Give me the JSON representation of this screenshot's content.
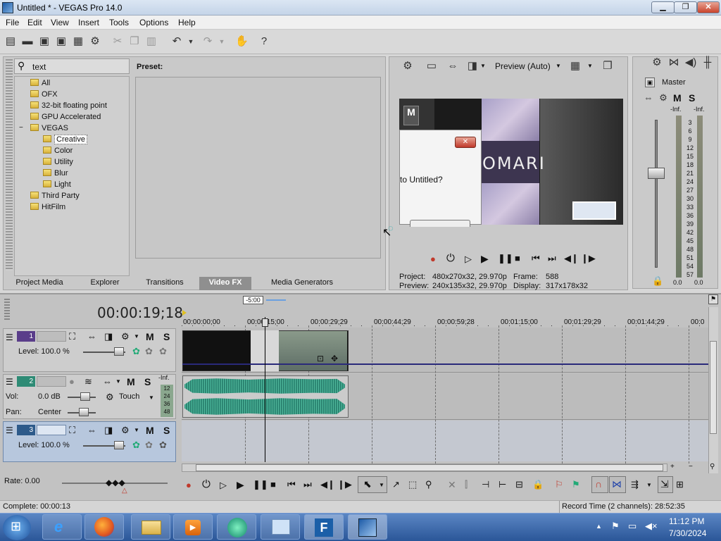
{
  "window": {
    "title": "Untitled * - VEGAS Pro 14.0",
    "minimize": "▁",
    "maximize": "❐",
    "close": "✕"
  },
  "menu": [
    "File",
    "Edit",
    "View",
    "Insert",
    "Tools",
    "Options",
    "Help"
  ],
  "fx_browser": {
    "search_value": "text",
    "preset_label": "Preset:",
    "tree": [
      {
        "label": "All",
        "indent": 1
      },
      {
        "label": "OFX",
        "indent": 1
      },
      {
        "label": "32-bit floating point",
        "indent": 1
      },
      {
        "label": "GPU Accelerated",
        "indent": 1
      },
      {
        "label": "VEGAS",
        "indent": 1,
        "expanded": true
      },
      {
        "label": "Creative",
        "indent": 2,
        "selected": true
      },
      {
        "label": "Color",
        "indent": 2
      },
      {
        "label": "Utility",
        "indent": 2
      },
      {
        "label": "Blur",
        "indent": 2
      },
      {
        "label": "Light",
        "indent": 2
      },
      {
        "label": "Third Party",
        "indent": 1
      },
      {
        "label": "HitFilm",
        "indent": 1
      }
    ],
    "tree_expander": "−",
    "tabs": [
      "Project Media",
      "Explorer",
      "Transitions",
      "Video FX",
      "Media Generators"
    ],
    "active_tab": "Video FX"
  },
  "preview": {
    "quality": "Preview (Auto)",
    "project_label": "Project:",
    "project_value": "480x270x32, 29.970p",
    "preview_label": "Preview:",
    "preview_value": "240x135x32, 29.970p",
    "frame_label": "Frame:",
    "frame_value": "588",
    "display_label": "Display:",
    "display_value": "317x178x32",
    "dialog_text": "to Untitled?",
    "overlay_text": "OMARI"
  },
  "mixer": {
    "title": "Master",
    "inf_left": "-Inf.",
    "inf_right": "-Inf.",
    "scale": [
      "3",
      "6",
      "9",
      "12",
      "15",
      "18",
      "21",
      "24",
      "27",
      "30",
      "33",
      "36",
      "39",
      "42",
      "45",
      "48",
      "51",
      "54",
      "57"
    ],
    "bottom_left": "0.0",
    "bottom_right": "0.0",
    "m": "M",
    "s": "S"
  },
  "timeline": {
    "timecode": "00:00:19;18",
    "cursor_offset": "-5:00",
    "ruler": [
      "00:00:00;00",
      "00:00:15;00",
      "00:00:29;29",
      "00:00:44;29",
      "00:00:59;28",
      "00:01:15;00",
      "00:01:29;29",
      "00:01:44;29",
      "00:0"
    ],
    "tracks": [
      {
        "num": "1",
        "level_label": "Level: 100.0 %"
      },
      {
        "num": "2",
        "vol_label": "Vol:",
        "vol_value": "0.0 dB",
        "pan_label": "Pan:",
        "pan_value": "Center",
        "automation": "Touch",
        "meter": [
          "-Inf.",
          "12",
          "24",
          "36",
          "48"
        ]
      },
      {
        "num": "3",
        "level_label": "Level: 100.0 %"
      }
    ],
    "m": "M",
    "s": "S",
    "rate": "Rate: 0.00"
  },
  "status": {
    "complete": "Complete: 00:00:13",
    "record_time": "Record Time (2 channels): 28:52:35"
  },
  "taskbar": {
    "time": "11:12 PM",
    "date": "7/30/2024"
  },
  "colors": {
    "accent_purple": "#5a3d8a",
    "accent_teal": "#2e8b75",
    "record_red": "#c0392b"
  }
}
